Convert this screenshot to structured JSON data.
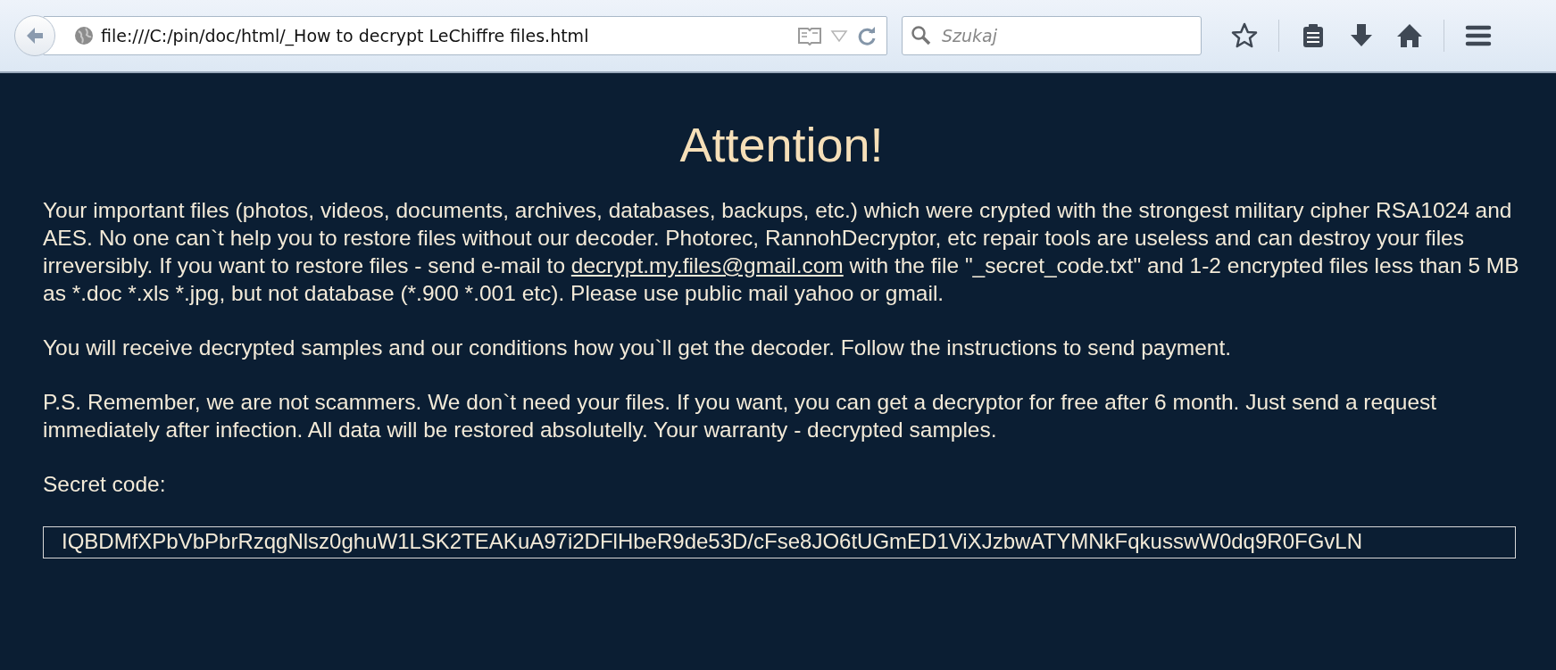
{
  "browser": {
    "url": "file:///C:/pin/doc/html/_How to decrypt LeChiffre files.html",
    "search_placeholder": "Szukaj"
  },
  "page": {
    "title": "Attention!",
    "paragraphs": [
      {
        "text": "Your important files (photos, videos, documents, archives, databases, backups, etc.) which were crypted with the strongest military cipher RSA1024 and AES. No one can`t help you to restore files without our decoder. Photorec, RannohDecryptor, etc repair tools are useless and can destroy your files irreversibly. If you want to restore files - send e-mail to",
        "link": "decrypt.my.files@gmail.com",
        "after": "with the file \"_secret_code.txt\" and 1-2 encrypted files less than 5 MB as *.doc *.xls *.jpg, but not database (*.900 *.001 etc). Please use public mail yahoo or gmail."
      },
      {
        "text": "You will receive decrypted samples and our conditions how you`ll get the decoder. Follow the instructions to send payment."
      },
      {
        "text": "P.S. Remember, we are not scammers. We don`t need your files. If you want, you can get a decryptor for free after 6 month. Just send a request immediately after infection. All data will be restored absolutelly. Your warranty - decrypted samples."
      }
    ],
    "secret_label": "Secret code:",
    "secret_code": "IQBDMfXPbVbPbrRzqgNlsz0ghuW1LSK2TEAKuA97i2DFlHbeR9de53D/cFse8JO6tUGmED1ViXJzbwATYMNkFqkusswW0dq9R0FGvLN"
  }
}
